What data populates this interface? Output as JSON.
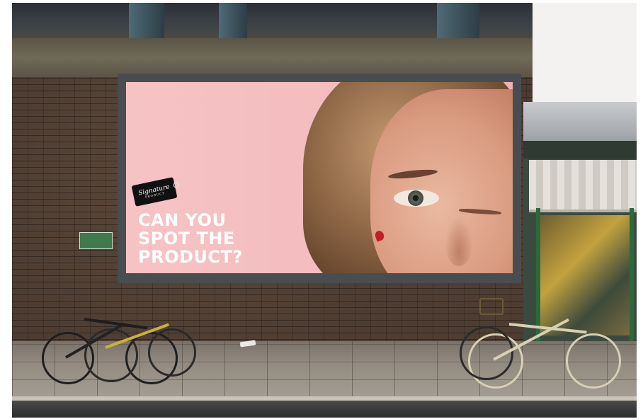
{
  "billboard": {
    "brand_logo": "Signature",
    "brand_logo_sub": "PRODUCT",
    "headline_lines": [
      "CAN YOU",
      "SPOT THE",
      "PRODUCT?"
    ]
  },
  "colors": {
    "billboard_background": "#f4bdbf",
    "headline_text": "#ffffff",
    "logo_background": "#111111",
    "product_mark": "#c41d27"
  },
  "scene": {
    "elements": [
      "railway-bridge",
      "brick-wall",
      "billboard",
      "shopfront",
      "bicycles",
      "wet-pavement",
      "road"
    ]
  }
}
